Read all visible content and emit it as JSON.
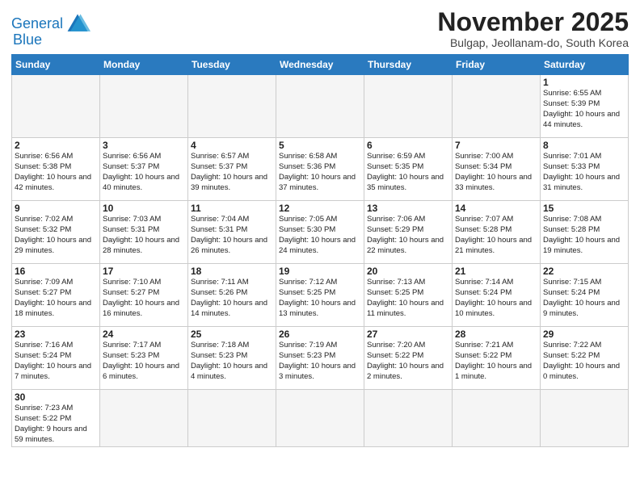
{
  "logo": {
    "line1": "General",
    "line2": "Blue"
  },
  "title": "November 2025",
  "subtitle": "Bulgap, Jeollanam-do, South Korea",
  "days_of_week": [
    "Sunday",
    "Monday",
    "Tuesday",
    "Wednesday",
    "Thursday",
    "Friday",
    "Saturday"
  ],
  "weeks": [
    [
      {
        "day": "",
        "info": "",
        "empty": true
      },
      {
        "day": "",
        "info": "",
        "empty": true
      },
      {
        "day": "",
        "info": "",
        "empty": true
      },
      {
        "day": "",
        "info": "",
        "empty": true
      },
      {
        "day": "",
        "info": "",
        "empty": true
      },
      {
        "day": "",
        "info": "",
        "empty": true
      },
      {
        "day": "1",
        "info": "Sunrise: 6:55 AM\nSunset: 5:39 PM\nDaylight: 10 hours and 44 minutes."
      }
    ],
    [
      {
        "day": "2",
        "info": "Sunrise: 6:56 AM\nSunset: 5:38 PM\nDaylight: 10 hours and 42 minutes."
      },
      {
        "day": "3",
        "info": "Sunrise: 6:56 AM\nSunset: 5:37 PM\nDaylight: 10 hours and 40 minutes."
      },
      {
        "day": "4",
        "info": "Sunrise: 6:57 AM\nSunset: 5:37 PM\nDaylight: 10 hours and 39 minutes."
      },
      {
        "day": "5",
        "info": "Sunrise: 6:58 AM\nSunset: 5:36 PM\nDaylight: 10 hours and 37 minutes."
      },
      {
        "day": "6",
        "info": "Sunrise: 6:59 AM\nSunset: 5:35 PM\nDaylight: 10 hours and 35 minutes."
      },
      {
        "day": "7",
        "info": "Sunrise: 7:00 AM\nSunset: 5:34 PM\nDaylight: 10 hours and 33 minutes."
      },
      {
        "day": "8",
        "info": "Sunrise: 7:01 AM\nSunset: 5:33 PM\nDaylight: 10 hours and 31 minutes."
      }
    ],
    [
      {
        "day": "9",
        "info": "Sunrise: 7:02 AM\nSunset: 5:32 PM\nDaylight: 10 hours and 29 minutes."
      },
      {
        "day": "10",
        "info": "Sunrise: 7:03 AM\nSunset: 5:31 PM\nDaylight: 10 hours and 28 minutes."
      },
      {
        "day": "11",
        "info": "Sunrise: 7:04 AM\nSunset: 5:31 PM\nDaylight: 10 hours and 26 minutes."
      },
      {
        "day": "12",
        "info": "Sunrise: 7:05 AM\nSunset: 5:30 PM\nDaylight: 10 hours and 24 minutes."
      },
      {
        "day": "13",
        "info": "Sunrise: 7:06 AM\nSunset: 5:29 PM\nDaylight: 10 hours and 22 minutes."
      },
      {
        "day": "14",
        "info": "Sunrise: 7:07 AM\nSunset: 5:28 PM\nDaylight: 10 hours and 21 minutes."
      },
      {
        "day": "15",
        "info": "Sunrise: 7:08 AM\nSunset: 5:28 PM\nDaylight: 10 hours and 19 minutes."
      }
    ],
    [
      {
        "day": "16",
        "info": "Sunrise: 7:09 AM\nSunset: 5:27 PM\nDaylight: 10 hours and 18 minutes."
      },
      {
        "day": "17",
        "info": "Sunrise: 7:10 AM\nSunset: 5:27 PM\nDaylight: 10 hours and 16 minutes."
      },
      {
        "day": "18",
        "info": "Sunrise: 7:11 AM\nSunset: 5:26 PM\nDaylight: 10 hours and 14 minutes."
      },
      {
        "day": "19",
        "info": "Sunrise: 7:12 AM\nSunset: 5:25 PM\nDaylight: 10 hours and 13 minutes."
      },
      {
        "day": "20",
        "info": "Sunrise: 7:13 AM\nSunset: 5:25 PM\nDaylight: 10 hours and 11 minutes."
      },
      {
        "day": "21",
        "info": "Sunrise: 7:14 AM\nSunset: 5:24 PM\nDaylight: 10 hours and 10 minutes."
      },
      {
        "day": "22",
        "info": "Sunrise: 7:15 AM\nSunset: 5:24 PM\nDaylight: 10 hours and 9 minutes."
      }
    ],
    [
      {
        "day": "23",
        "info": "Sunrise: 7:16 AM\nSunset: 5:24 PM\nDaylight: 10 hours and 7 minutes."
      },
      {
        "day": "24",
        "info": "Sunrise: 7:17 AM\nSunset: 5:23 PM\nDaylight: 10 hours and 6 minutes."
      },
      {
        "day": "25",
        "info": "Sunrise: 7:18 AM\nSunset: 5:23 PM\nDaylight: 10 hours and 4 minutes."
      },
      {
        "day": "26",
        "info": "Sunrise: 7:19 AM\nSunset: 5:23 PM\nDaylight: 10 hours and 3 minutes."
      },
      {
        "day": "27",
        "info": "Sunrise: 7:20 AM\nSunset: 5:22 PM\nDaylight: 10 hours and 2 minutes."
      },
      {
        "day": "28",
        "info": "Sunrise: 7:21 AM\nSunset: 5:22 PM\nDaylight: 10 hours and 1 minute."
      },
      {
        "day": "29",
        "info": "Sunrise: 7:22 AM\nSunset: 5:22 PM\nDaylight: 10 hours and 0 minutes."
      }
    ],
    [
      {
        "day": "30",
        "info": "Sunrise: 7:23 AM\nSunset: 5:22 PM\nDaylight: 9 hours and 59 minutes."
      },
      {
        "day": "",
        "info": "",
        "empty": true
      },
      {
        "day": "",
        "info": "",
        "empty": true
      },
      {
        "day": "",
        "info": "",
        "empty": true
      },
      {
        "day": "",
        "info": "",
        "empty": true
      },
      {
        "day": "",
        "info": "",
        "empty": true
      },
      {
        "day": "",
        "info": "",
        "empty": true
      }
    ]
  ]
}
